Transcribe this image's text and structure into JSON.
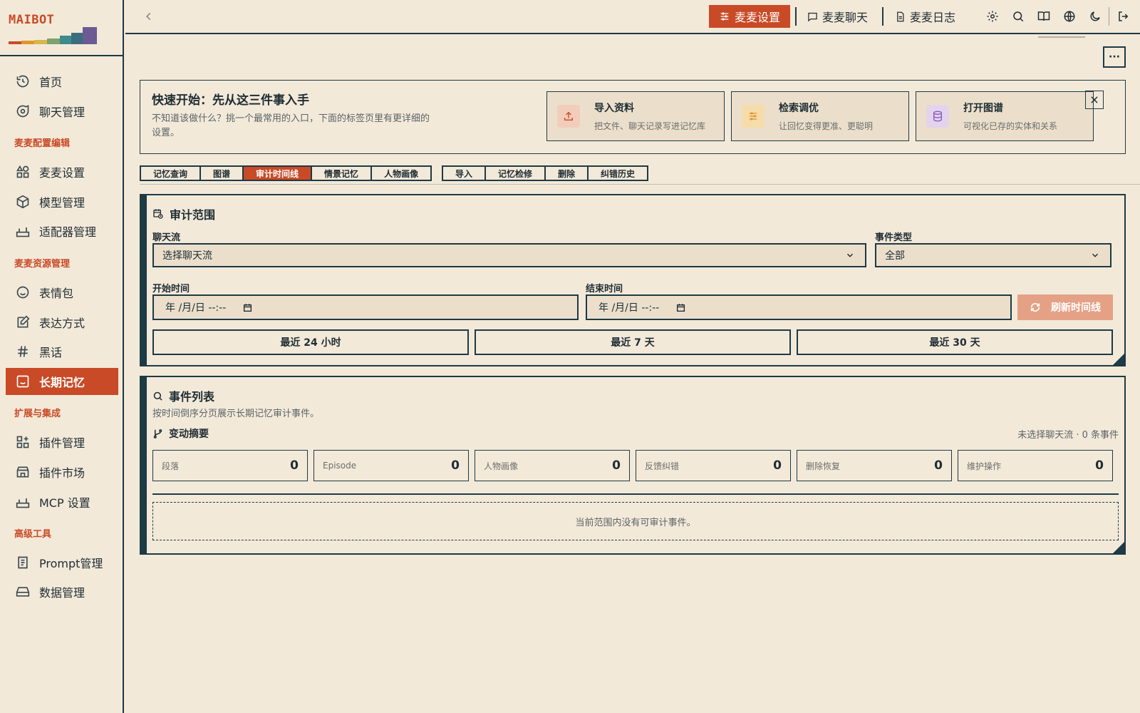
{
  "brand": {
    "name": "MAIBOT"
  },
  "sidebar": {
    "items": [
      {
        "label": "首页",
        "icon": "history-icon"
      },
      {
        "label": "聊天管理",
        "icon": "chat-icon"
      },
      {
        "label": "麦麦设置",
        "icon": "shapes-icon"
      },
      {
        "label": "模型管理",
        "icon": "cube-icon"
      },
      {
        "label": "适配器管理",
        "icon": "router-icon"
      },
      {
        "label": "表情包",
        "icon": "smile-icon"
      },
      {
        "label": "表达方式",
        "icon": "edit-icon"
      },
      {
        "label": "黑话",
        "icon": "hash-icon"
      },
      {
        "label": "长期记忆",
        "icon": "memory-icon",
        "active": true
      },
      {
        "label": "插件管理",
        "icon": "plugin-icon"
      },
      {
        "label": "插件市场",
        "icon": "store-icon"
      },
      {
        "label": "MCP 设置",
        "icon": "router-icon"
      },
      {
        "label": "Prompt管理",
        "icon": "document-icon"
      },
      {
        "label": "数据管理",
        "icon": "drive-icon"
      }
    ],
    "sections": [
      "麦麦配置编辑",
      "麦麦资源管理",
      "扩展与集成",
      "高级工具"
    ]
  },
  "topbar": {
    "nav": [
      "麦麦设置",
      "麦麦聊天",
      "麦麦日志"
    ],
    "icons": [
      "gear-icon",
      "search-icon",
      "book-icon",
      "globe-icon",
      "moon-icon",
      "logout-icon"
    ]
  },
  "more_label": "···",
  "quickstart": {
    "title": "快速开始：先从这三件事入手",
    "desc": "不知道该做什么？挑一个最常用的入口，下面的标签页里有更详细的设置。",
    "cards": [
      {
        "title": "导入资料",
        "sub": "把文件、聊天记录写进记忆库",
        "icon": "upload-icon",
        "color": "#c94a26"
      },
      {
        "title": "检索调优",
        "sub": "让回忆变得更准、更聪明",
        "icon": "sliders-icon",
        "color": "#e0962b"
      },
      {
        "title": "打开图谱",
        "sub": "可视化已存的实体和关系",
        "icon": "database-icon",
        "color": "#8a58c4"
      }
    ]
  },
  "tabs": {
    "group1": [
      "记忆查询",
      "图谱",
      "审计时间线",
      "情景记忆",
      "人物画像"
    ],
    "group2": [
      "导入",
      "记忆检修",
      "删除",
      "纠错历史"
    ],
    "active": "审计时间线"
  },
  "audit_range": {
    "title": "审计范围",
    "chat_label": "聊天流",
    "chat_placeholder": "选择聊天流",
    "event_label": "事件类型",
    "event_value": "全部",
    "start_label": "开始时间",
    "end_label": "结束时间",
    "date_placeholder": "年 /月/日 --:--",
    "refresh_label": "刷新时间线",
    "ranges": [
      "最近 24 小时",
      "最近 7 天",
      "最近 30 天"
    ]
  },
  "event_list": {
    "title": "事件列表",
    "desc": "按时间倒序分页展示长期记忆审计事件。",
    "summary_title": "变动摘要",
    "summary_status": "未选择聊天流 · 0 条事件",
    "stats": [
      {
        "label": "段落",
        "value": "0"
      },
      {
        "label": "Episode",
        "value": "0"
      },
      {
        "label": "人物画像",
        "value": "0"
      },
      {
        "label": "反馈纠错",
        "value": "0"
      },
      {
        "label": "删除恢复",
        "value": "0"
      },
      {
        "label": "维护操作",
        "value": "0"
      }
    ],
    "empty": "当前范围内没有可审计事件。"
  },
  "colors": {
    "accent": "#c94a26",
    "ink": "#1d3a45",
    "background": "#f3e9d9"
  }
}
